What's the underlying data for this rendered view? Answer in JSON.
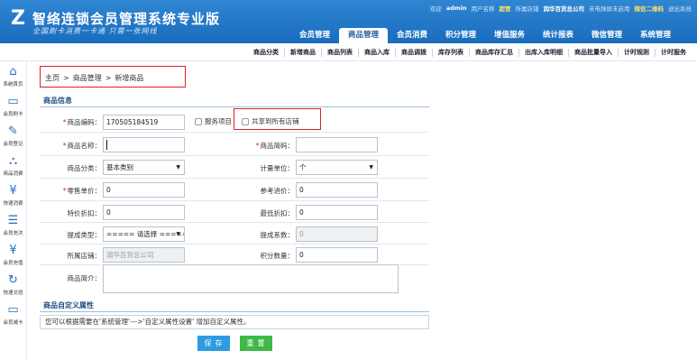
{
  "header": {
    "title": "智络连锁会员管理系统专业版",
    "slogan": "全国刷卡消费一卡通  只需一张网线",
    "topbar": {
      "welcome": "欢迎",
      "user": "admin",
      "role_label": "用户名称",
      "role": "超管",
      "store_label": "所属店铺",
      "store": "润华百货总公司",
      "sms": "未电弹屏未启用",
      "wechat": "微信二维码",
      "logout": "退出系统"
    },
    "nav": [
      "会员管理",
      "商品管理",
      "会员消费",
      "积分管理",
      "增值服务",
      "统计报表",
      "微信管理",
      "系统管理"
    ],
    "active_nav": "商品管理"
  },
  "subnav": [
    "商品分类",
    "新增商品",
    "商品列表",
    "商品入库",
    "商品调拨",
    "库存列表",
    "商品库存汇总",
    "出库入库明细",
    "商品批量导入",
    "计时规则",
    "计时服务"
  ],
  "sidebar": [
    {
      "label": "系统首页",
      "icon": "home-icon"
    },
    {
      "label": "会员刷卡",
      "icon": "card-icon"
    },
    {
      "label": "会员登记",
      "icon": "register-icon"
    },
    {
      "label": "商品消费",
      "icon": "bag-icon"
    },
    {
      "label": "快速消费",
      "icon": "yen-icon"
    },
    {
      "label": "会员充次",
      "icon": "list-icon"
    },
    {
      "label": "会员充值",
      "icon": "recharge-icon"
    },
    {
      "label": "快速交班",
      "icon": "refresh-icon"
    },
    {
      "label": "会员减卡",
      "icon": "card2-icon"
    }
  ],
  "breadcrumb": [
    "主页",
    ">",
    "商品管理",
    ">",
    "新增商品"
  ],
  "form": {
    "section_title": "商品信息",
    "code_label": "商品编码：",
    "code_value": "170505184519",
    "service_label": "服务项目",
    "share_label": "共享到所有店铺",
    "name_label": "商品名称：",
    "name_value": "",
    "short_label": "商品简码：",
    "short_value": "",
    "category_label": "商品分类：",
    "category_value": "基本类别",
    "unit_label": "计量单位：",
    "unit_value": "个",
    "price_label": "零售单价：",
    "price_value": "0",
    "ref_price_label": "参考进价：",
    "ref_price_value": "0",
    "discount_label": "特价折扣：",
    "discount_value": "0",
    "min_discount_label": "最低折扣：",
    "min_discount_value": "0",
    "commission_type_label": "提成类型：",
    "commission_type_value": "===== 请选择 =====",
    "commission_rate_label": "提成系数：",
    "commission_rate_value": "0",
    "store_label": "所属店铺：",
    "store_value": "润华百货总公司",
    "points_label": "积分数量：",
    "points_value": "0",
    "intro_label": "商品简介：",
    "intro_value": ""
  },
  "custom": {
    "section_title": "商品自定义属性",
    "note": "您可以根据需要在'系统管理'--->'自定义属性设置' 增加自定义属性。"
  },
  "buttons": {
    "save": "保存",
    "reset": "重置"
  },
  "colors": {
    "header_blue": "#1a6cbd",
    "highlight_red": "#e02020",
    "save_blue": "#2e9be0",
    "reset_green": "#40b847"
  }
}
